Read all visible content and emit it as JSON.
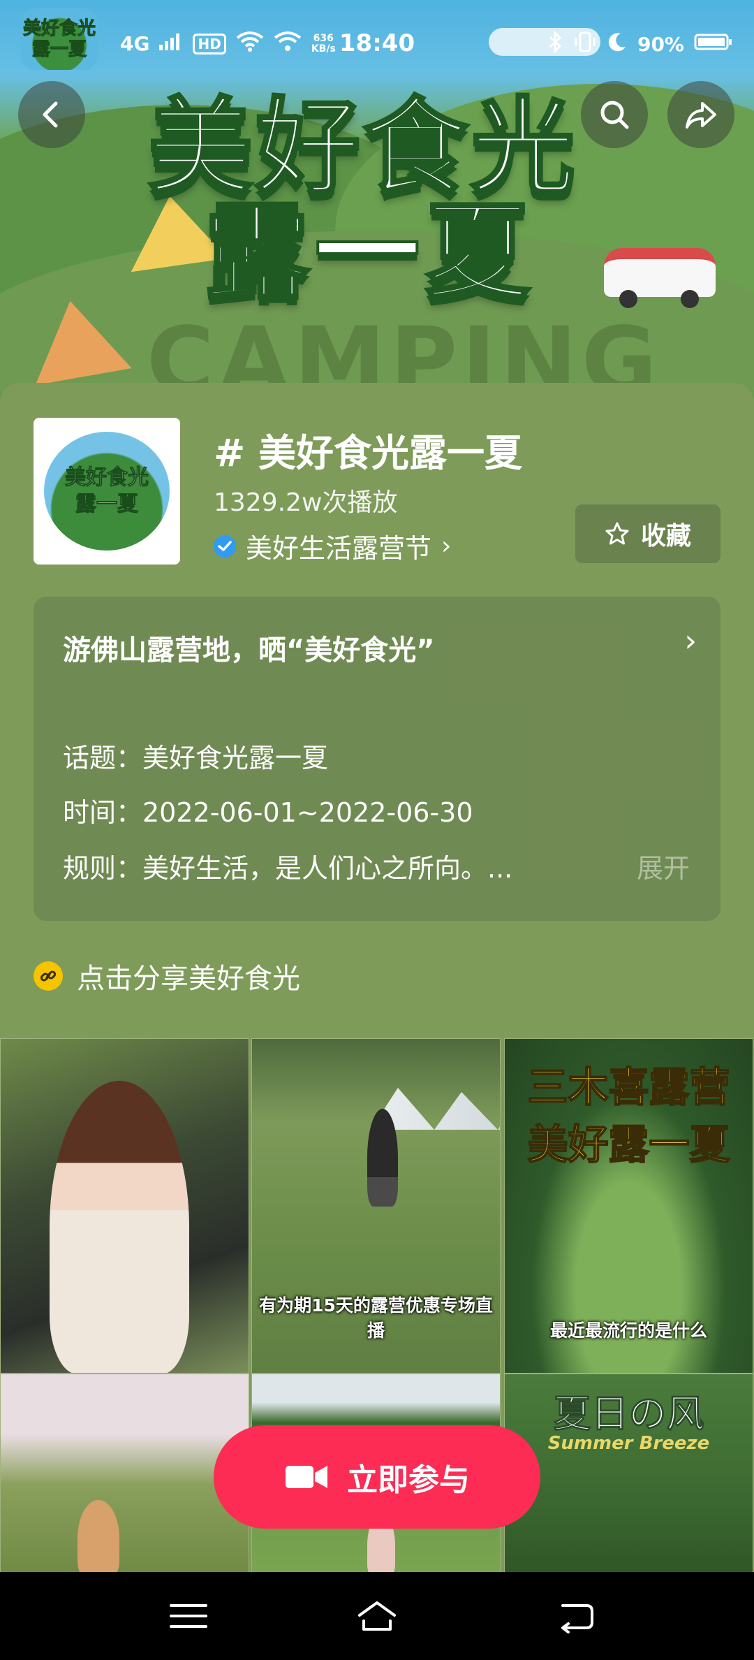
{
  "status_bar": {
    "app_badge": "美好食光\n露一夏",
    "network": "4G",
    "hd": "HD",
    "speed_value": "636",
    "speed_unit": "KB/s",
    "time": "18:40",
    "battery": "90%"
  },
  "banner": {
    "title_line1": "美好食光",
    "title_line2": "露一夏",
    "background_text": "CAMPING"
  },
  "topic": {
    "thumb_text_line1": "美好食光",
    "thumb_text_line2": "露一夏",
    "title": "# 美好食光露一夏",
    "plays": "1329.2w次播放",
    "organizer": "美好生活露营节",
    "collect_label": "收藏"
  },
  "activity": {
    "title": "游佛山露营地，晒“美好食光”",
    "topic_line": "话题：美好食光露一夏",
    "time_line": "时间：2022-06-01~2022-06-30",
    "rules_line": "规则：美好生活，是人们心之所向。...",
    "expand_label": "展开"
  },
  "share": {
    "text": "点击分享美好食光"
  },
  "videos": [
    {
      "caption": ""
    },
    {
      "caption": "有为期15天的露营优惠专场直播"
    },
    {
      "caption": "最近最流行的是什么",
      "overlay_line1": "三木喜露营",
      "overlay_line2": "美好露一夏"
    },
    {
      "caption": ""
    },
    {
      "caption": ""
    },
    {
      "caption": "",
      "overlay_line1": "夏日の风",
      "overlay_line2": "Summer Breeze"
    }
  ],
  "join_button": {
    "label": "立即参与"
  },
  "colors": {
    "page_bg": "#7e9b5a",
    "join_button": "#fc2c55",
    "verified": "#2f9bf2",
    "link_icon": "#f6c400"
  }
}
